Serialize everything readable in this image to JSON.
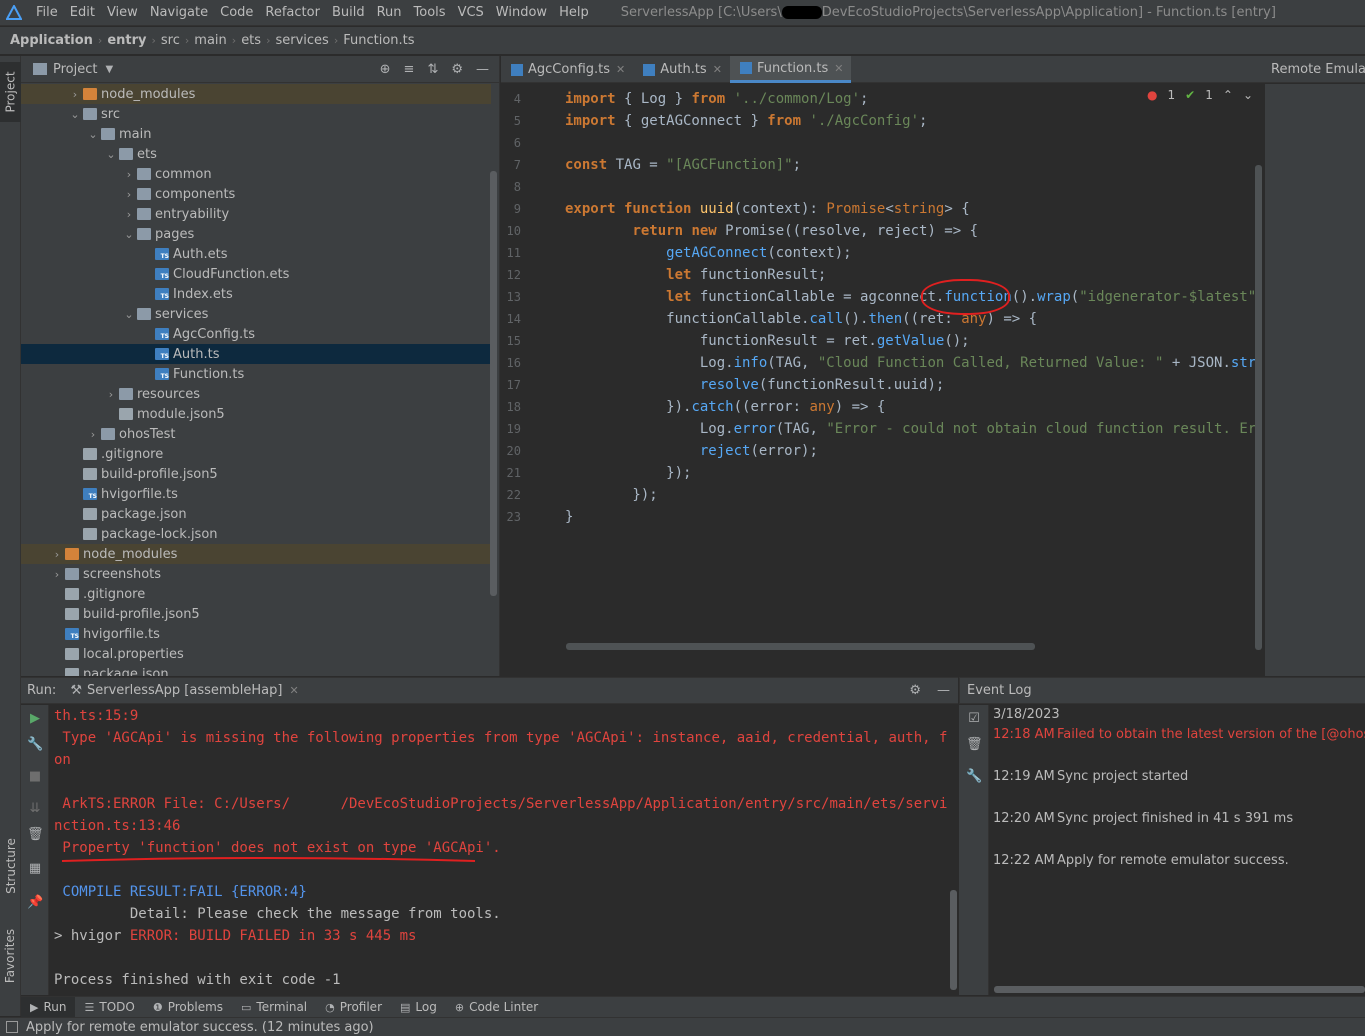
{
  "menubar": {
    "items": [
      "File",
      "Edit",
      "View",
      "Navigate",
      "Code",
      "Refactor",
      "Build",
      "Run",
      "Tools",
      "VCS",
      "Window",
      "Help"
    ],
    "title_prefix": "ServerlessApp [C:\\Users\\",
    "title_suffix": "DevEcoStudioProjects\\ServerlessApp\\Application] - Function.ts [entry]"
  },
  "breadcrumb": [
    "Application",
    "entry",
    "src",
    "main",
    "ets",
    "services",
    "Function.ts"
  ],
  "project_panel": {
    "title": "Project",
    "tree": [
      {
        "label": "node_modules",
        "depth": 2,
        "arrow": "closed",
        "icon": "folder-orange",
        "state": "excluded"
      },
      {
        "label": "src",
        "depth": 2,
        "arrow": "open",
        "icon": "folder"
      },
      {
        "label": "main",
        "depth": 3,
        "arrow": "open",
        "icon": "folder"
      },
      {
        "label": "ets",
        "depth": 4,
        "arrow": "open",
        "icon": "folder"
      },
      {
        "label": "common",
        "depth": 5,
        "arrow": "closed",
        "icon": "folder"
      },
      {
        "label": "components",
        "depth": 5,
        "arrow": "closed",
        "icon": "folder"
      },
      {
        "label": "entryability",
        "depth": 5,
        "arrow": "closed",
        "icon": "folder"
      },
      {
        "label": "pages",
        "depth": 5,
        "arrow": "open",
        "icon": "folder"
      },
      {
        "label": "Auth.ets",
        "depth": 6,
        "arrow": "none",
        "icon": "file-ts"
      },
      {
        "label": "CloudFunction.ets",
        "depth": 6,
        "arrow": "none",
        "icon": "file-ts"
      },
      {
        "label": "Index.ets",
        "depth": 6,
        "arrow": "none",
        "icon": "file-ts"
      },
      {
        "label": "services",
        "depth": 5,
        "arrow": "open",
        "icon": "folder"
      },
      {
        "label": "AgcConfig.ts",
        "depth": 6,
        "arrow": "none",
        "icon": "file-ts"
      },
      {
        "label": "Auth.ts",
        "depth": 6,
        "arrow": "none",
        "icon": "file-ts",
        "state": "selected"
      },
      {
        "label": "Function.ts",
        "depth": 6,
        "arrow": "none",
        "icon": "file-ts"
      },
      {
        "label": "resources",
        "depth": 4,
        "arrow": "closed",
        "icon": "folder"
      },
      {
        "label": "module.json5",
        "depth": 4,
        "arrow": "none",
        "icon": "file-gen"
      },
      {
        "label": "ohosTest",
        "depth": 3,
        "arrow": "closed",
        "icon": "folder"
      },
      {
        "label": ".gitignore",
        "depth": 2,
        "arrow": "none",
        "icon": "file-gen"
      },
      {
        "label": "build-profile.json5",
        "depth": 2,
        "arrow": "none",
        "icon": "file-gen"
      },
      {
        "label": "hvigorfile.ts",
        "depth": 2,
        "arrow": "none",
        "icon": "file-ts"
      },
      {
        "label": "package.json",
        "depth": 2,
        "arrow": "none",
        "icon": "file-gen"
      },
      {
        "label": "package-lock.json",
        "depth": 2,
        "arrow": "none",
        "icon": "file-gen"
      },
      {
        "label": "node_modules",
        "depth": 1,
        "arrow": "closed",
        "icon": "folder-orange",
        "state": "excluded"
      },
      {
        "label": "screenshots",
        "depth": 1,
        "arrow": "closed",
        "icon": "folder"
      },
      {
        "label": ".gitignore",
        "depth": 1,
        "arrow": "none",
        "icon": "file-gen"
      },
      {
        "label": "build-profile.json5",
        "depth": 1,
        "arrow": "none",
        "icon": "file-gen"
      },
      {
        "label": "hvigorfile.ts",
        "depth": 1,
        "arrow": "none",
        "icon": "file-ts"
      },
      {
        "label": "local.properties",
        "depth": 1,
        "arrow": "none",
        "icon": "file-gen"
      },
      {
        "label": "package.json",
        "depth": 1,
        "arrow": "none",
        "icon": "file-gen"
      }
    ]
  },
  "editor": {
    "tabs": [
      {
        "label": "AgcConfig.ts",
        "active": false
      },
      {
        "label": "Auth.ts",
        "active": false
      },
      {
        "label": "Function.ts",
        "active": true
      }
    ],
    "inspections": {
      "errors": "1",
      "warnings": "1"
    },
    "line_numbers": [
      "4",
      "5",
      "6",
      "7",
      "8",
      "9",
      "10",
      "11",
      "12",
      "13",
      "14",
      "15",
      "16",
      "17",
      "18",
      "19",
      "20",
      "21",
      "22",
      "23"
    ],
    "code_lines": [
      [
        [
          "kw",
          "import"
        ],
        [
          "p",
          " { Log } "
        ],
        [
          "kw",
          "from"
        ],
        [
          "p",
          " "
        ],
        [
          "str",
          "'../common/Log'"
        ],
        [
          "p",
          ";"
        ]
      ],
      [
        [
          "kw",
          "import"
        ],
        [
          "p",
          " { getAGConnect } "
        ],
        [
          "kw",
          "from"
        ],
        [
          "p",
          " "
        ],
        [
          "str",
          "'./AgcConfig'"
        ],
        [
          "p",
          ";"
        ]
      ],
      [],
      [
        [
          "kw",
          "const"
        ],
        [
          "p",
          " TAG = "
        ],
        [
          "str",
          "\"[AGCFunction]\""
        ],
        [
          "p",
          ";"
        ]
      ],
      [],
      [
        [
          "kw",
          "export function"
        ],
        [
          "p",
          " "
        ],
        [
          "fn",
          "uuid"
        ],
        [
          "p",
          "(context): "
        ],
        [
          "ty",
          "Promise"
        ],
        [
          "p",
          "<"
        ],
        [
          "ty",
          "string"
        ],
        [
          "p",
          "> {"
        ]
      ],
      [
        [
          "p",
          "        "
        ],
        [
          "kw",
          "return new"
        ],
        [
          "p",
          " Promise((resolve, reject) => {"
        ]
      ],
      [
        [
          "p",
          "            "
        ],
        [
          "method",
          "getAGConnect"
        ],
        [
          "p",
          "(context);"
        ]
      ],
      [
        [
          "p",
          "            "
        ],
        [
          "kw",
          "let"
        ],
        [
          "p",
          " functionResult;"
        ]
      ],
      [
        [
          "p",
          "            "
        ],
        [
          "kw",
          "let"
        ],
        [
          "p",
          " functionCallable = agconnect."
        ],
        [
          "method",
          "function"
        ],
        [
          "p",
          "()."
        ],
        [
          "method",
          "wrap"
        ],
        [
          "p",
          "("
        ],
        [
          "str",
          "\"idgenerator-$latest\""
        ],
        [
          "p",
          ");"
        ]
      ],
      [
        [
          "p",
          "            functionCallable."
        ],
        [
          "method",
          "call"
        ],
        [
          "p",
          "()."
        ],
        [
          "method",
          "then"
        ],
        [
          "p",
          "((ret: "
        ],
        [
          "ty",
          "any"
        ],
        [
          "p",
          ") => {"
        ]
      ],
      [
        [
          "p",
          "                functionResult = ret."
        ],
        [
          "method",
          "getValue"
        ],
        [
          "p",
          "();"
        ]
      ],
      [
        [
          "p",
          "                Log."
        ],
        [
          "method",
          "info"
        ],
        [
          "p",
          "(TAG, "
        ],
        [
          "str",
          "\"Cloud Function Called, Returned Value: \""
        ],
        [
          "p",
          " + JSON."
        ],
        [
          "method",
          "stringify"
        ]
      ],
      [
        [
          "p",
          "                "
        ],
        [
          "method",
          "resolve"
        ],
        [
          "p",
          "(functionResult.uuid);"
        ]
      ],
      [
        [
          "p",
          "            })."
        ],
        [
          "method",
          "catch"
        ],
        [
          "p",
          "((error: "
        ],
        [
          "ty",
          "any"
        ],
        [
          "p",
          ") => {"
        ]
      ],
      [
        [
          "p",
          "                Log."
        ],
        [
          "method",
          "error"
        ],
        [
          "p",
          "(TAG, "
        ],
        [
          "str",
          "\"Error - could not obtain cloud function result. Error De"
        ]
      ],
      [
        [
          "p",
          "                "
        ],
        [
          "method",
          "reject"
        ],
        [
          "p",
          "(error);"
        ]
      ],
      [
        [
          "p",
          "            });"
        ]
      ],
      [
        [
          "p",
          "        });"
        ]
      ],
      [
        [
          "p",
          "}"
        ]
      ]
    ]
  },
  "right_panel": {
    "title": "Remote Emulator"
  },
  "run_panel": {
    "label": "Run:",
    "tab": "ServerlessApp [assembleHap]",
    "output": [
      {
        "cls": "red",
        "text": "th.ts:15:9"
      },
      {
        "cls": "red",
        "text": " Type 'AGCApi' is missing the following properties from type 'AGCApi': instance, aaid, credential, auth, functi"
      },
      {
        "cls": "red",
        "text": "on"
      },
      {
        "cls": "plain",
        "text": ""
      },
      {
        "cls": "red",
        "text": " ArkTS:ERROR File: C:/Users/      /DevEcoStudioProjects/ServerlessApp/Application/entry/src/main/ets/services/Fu"
      },
      {
        "cls": "red",
        "text": "nction.ts:13:46"
      },
      {
        "cls": "red",
        "text": " Property 'function' does not exist on type 'AGCApi'."
      },
      {
        "cls": "plain",
        "text": ""
      },
      {
        "cls": "blue",
        "text": " COMPILE RESULT:FAIL {ERROR:4}"
      },
      {
        "cls": "plain",
        "text": "         Detail: Please check the message from tools."
      },
      {
        "cls": "mixed",
        "text": "> hvigor ",
        "text2": "ERROR: BUILD FAILED in 33 s 445 ms"
      },
      {
        "cls": "plain",
        "text": ""
      },
      {
        "cls": "plain",
        "text": "Process finished with exit code -1"
      }
    ]
  },
  "event_log": {
    "title": "Event Log",
    "date": "3/18/2023",
    "entries": [
      {
        "time": "12:18 AM",
        "text": "Failed to obtain the latest version of the [@ohos/agc",
        "error": true
      },
      {
        "time": "12:19 AM",
        "text": "Sync project started",
        "error": false
      },
      {
        "time": "12:20 AM",
        "text": "Sync project finished in 41 s 391 ms",
        "error": false
      },
      {
        "time": "12:22 AM",
        "text": "Apply for remote emulator success.",
        "error": false
      }
    ]
  },
  "side_tabs": {
    "project": "Project",
    "structure": "Structure",
    "favorites": "Favorites"
  },
  "bottom_tabs": [
    {
      "label": "Run",
      "icon": "▶",
      "active": true
    },
    {
      "label": "TODO",
      "icon": "☰",
      "active": false
    },
    {
      "label": "Problems",
      "icon": "❶",
      "active": false
    },
    {
      "label": "Terminal",
      "icon": "▭",
      "active": false
    },
    {
      "label": "Profiler",
      "icon": "◔",
      "active": false
    },
    {
      "label": "Log",
      "icon": "▤",
      "active": false
    },
    {
      "label": "Code Linter",
      "icon": "⊕",
      "active": false
    }
  ],
  "status": {
    "message": "Apply for remote emulator success. (12 minutes ago)"
  },
  "colors": {
    "accent": "#4a88c7",
    "error": "#e0443e",
    "annotation": "#e02020"
  }
}
